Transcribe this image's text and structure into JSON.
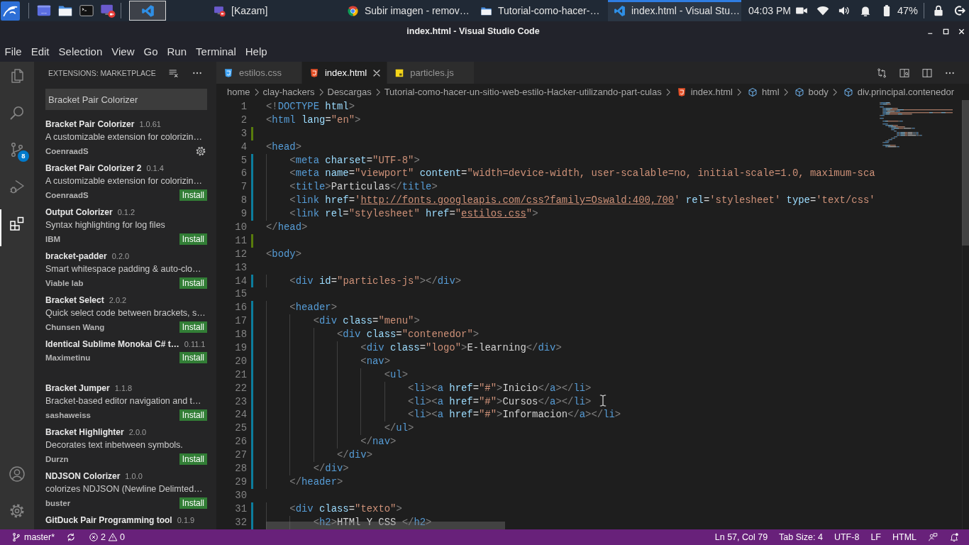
{
  "panel": {
    "launcher_groups": [
      [
        {
          "kind": "menu"
        }
      ],
      [
        {
          "kind": "window"
        },
        {
          "kind": "folder"
        },
        {
          "kind": "terminal"
        },
        {
          "kind": "recorder"
        }
      ]
    ],
    "workspaces": [
      {
        "kind": "editor",
        "selected": true
      }
    ],
    "tasks": [
      {
        "kind": "recorder",
        "label": "[Kazam]",
        "selected": false
      },
      {
        "kind": "browser",
        "label": "Subir imagen - remov…",
        "selected": false
      },
      {
        "kind": "folder",
        "label": "Tutorial-como-hacer-…",
        "selected": false
      },
      {
        "kind": "editor",
        "label": "index.html - Visual Stu…",
        "selected": true
      }
    ],
    "clock": "04:03 PM",
    "tray": [
      {
        "kind": "camera"
      },
      {
        "kind": "wifi"
      },
      {
        "kind": "volume"
      },
      {
        "kind": "bell"
      },
      {
        "kind": "battery"
      }
    ],
    "battery": "47%",
    "session": [
      {
        "kind": "lock"
      },
      {
        "kind": "logout"
      }
    ]
  },
  "window": {
    "title": "index.html - Visual Studio Code"
  },
  "menu": [
    "File",
    "Edit",
    "Selection",
    "View",
    "Go",
    "Run",
    "Terminal",
    "Help"
  ],
  "activity_bar": {
    "items": [
      {
        "kind": "explorer",
        "selected": false
      },
      {
        "kind": "search",
        "selected": false
      },
      {
        "kind": "source-control",
        "selected": false,
        "badge": "8"
      },
      {
        "kind": "run",
        "selected": false
      },
      {
        "kind": "extensions",
        "selected": true
      }
    ],
    "bottom": [
      {
        "kind": "account"
      },
      {
        "kind": "settings"
      }
    ]
  },
  "sidebar": {
    "title": "EXTENSIONS: MARKETPLACE",
    "search": {
      "value": "Bracket Pair Colorizer"
    },
    "extensions": [
      {
        "name": "Bracket Pair Colorizer",
        "version": "1.0.61",
        "description": "A customizable extension for colorizin…",
        "publisher": "CoenraadS",
        "installed": true
      },
      {
        "name": "Bracket Pair Colorizer 2",
        "version": "0.1.4",
        "description": "A customizable extension for colorizin…",
        "publisher": "CoenraadS",
        "installed": false,
        "install_label": "Install"
      },
      {
        "name": "Output Colorizer",
        "version": "0.1.2",
        "description": "Syntax highlighting for log files",
        "publisher": "IBM",
        "installed": false,
        "install_label": "Install"
      },
      {
        "name": "bracket-padder",
        "version": "0.2.0",
        "description": "Smart whitespace padding & auto-clo…",
        "publisher": "Viable lab",
        "installed": false,
        "install_label": "Install"
      },
      {
        "name": "Bracket Select",
        "version": "2.0.2",
        "description": "Quick select code between brackets, s…",
        "publisher": "Chunsen Wang",
        "installed": false,
        "install_label": "Install"
      },
      {
        "name": "Identical Sublime Monokai C# t…",
        "version": "0.11.1",
        "publisher": "Maximetinu",
        "installed": false,
        "install_label": "Install"
      },
      {
        "name": "Bracket Jumper",
        "version": "1.1.8",
        "description": "Bracket-based editor navigation and t…",
        "publisher": "sashaweiss",
        "installed": false,
        "install_label": "Install"
      },
      {
        "name": "Bracket Highlighter",
        "version": "2.0.0",
        "description": "Decorates text inbetween symbols.",
        "publisher": "Durzn",
        "installed": false,
        "install_label": "Install"
      },
      {
        "name": "NDJSON Colorizer",
        "version": "1.0.0",
        "description": "colorizes NDJSON (Newline Delimted…",
        "publisher": "buster",
        "installed": false,
        "install_label": "Install"
      },
      {
        "name": "GitDuck Pair Programming tool",
        "version": "0.1.9"
      }
    ]
  },
  "editor": {
    "tabs": [
      {
        "kind": "css",
        "label": "estilos.css",
        "selected": false
      },
      {
        "kind": "html",
        "label": "index.html",
        "selected": true
      },
      {
        "kind": "js",
        "label": "particles.js",
        "selected": false
      }
    ],
    "breadcrumb": [
      {
        "kind": "folder",
        "label": "home"
      },
      {
        "kind": "folder",
        "label": "clay-hackers"
      },
      {
        "kind": "folder",
        "label": "Descargas"
      },
      {
        "kind": "folder",
        "label": "Tutorial-como-hacer-un-sitio-web-estilo-Hacker-utilizando-part-culas"
      },
      {
        "kind": "html-file",
        "label": "index.html"
      },
      {
        "kind": "element",
        "label": "html"
      },
      {
        "kind": "element",
        "label": "body"
      },
      {
        "kind": "element",
        "label": "div.principal.contenedor"
      }
    ],
    "lines": [
      {
        "number": "1",
        "added": false,
        "modified": false,
        "tokens": [
          {
            "kind": "punct",
            "text": "<!"
          },
          {
            "kind": "tag",
            "text": "DOCTYPE"
          },
          {
            "kind": "attr",
            "text": " html"
          },
          {
            "kind": "punct",
            "text": ">"
          }
        ]
      },
      {
        "number": "2",
        "added": false,
        "modified": false,
        "tokens": [
          {
            "kind": "punct",
            "text": "<"
          },
          {
            "kind": "tag",
            "text": "html"
          },
          {
            "kind": "attr",
            "text": " lang"
          },
          {
            "kind": "text",
            "text": "="
          },
          {
            "kind": "string",
            "text": "\"en\""
          },
          {
            "kind": "punct",
            "text": ">"
          }
        ]
      },
      {
        "number": "3",
        "added": true,
        "modified": false
      },
      {
        "number": "4",
        "added": false,
        "modified": false,
        "tokens": [
          {
            "kind": "punct",
            "text": "<"
          },
          {
            "kind": "tag",
            "text": "head"
          },
          {
            "kind": "punct",
            "text": ">"
          }
        ]
      },
      {
        "number": "5",
        "added": false,
        "modified": true,
        "tokens": [
          {
            "kind": "punct",
            "text": "    <"
          },
          {
            "kind": "tag",
            "text": "meta"
          },
          {
            "kind": "attr",
            "text": " charset"
          },
          {
            "kind": "text",
            "text": "="
          },
          {
            "kind": "string",
            "text": "\"UTF-8\""
          },
          {
            "kind": "punct",
            "text": ">"
          }
        ]
      },
      {
        "number": "6",
        "added": false,
        "modified": true,
        "tokens": [
          {
            "kind": "punct",
            "text": "    <"
          },
          {
            "kind": "tag",
            "text": "meta"
          },
          {
            "kind": "attr",
            "text": " name"
          },
          {
            "kind": "text",
            "text": "="
          },
          {
            "kind": "string",
            "text": "\"viewport\""
          },
          {
            "kind": "attr",
            "text": " content"
          },
          {
            "kind": "text",
            "text": "="
          },
          {
            "kind": "string",
            "text": "\"width=device-width, user-scalable=no, initial-scale=1.0, maximum-sca"
          }
        ]
      },
      {
        "number": "7",
        "added": false,
        "modified": true,
        "tokens": [
          {
            "kind": "punct",
            "text": "    <"
          },
          {
            "kind": "tag",
            "text": "title"
          },
          {
            "kind": "punct",
            "text": ">"
          },
          {
            "kind": "text",
            "text": "Particulas"
          },
          {
            "kind": "punct",
            "text": "</"
          },
          {
            "kind": "tag",
            "text": "title"
          },
          {
            "kind": "punct",
            "text": ">"
          }
        ]
      },
      {
        "number": "8",
        "added": false,
        "modified": true,
        "tokens": [
          {
            "kind": "punct",
            "text": "    <"
          },
          {
            "kind": "tag",
            "text": "link"
          },
          {
            "kind": "attr",
            "text": " href"
          },
          {
            "kind": "text",
            "text": "="
          },
          {
            "kind": "string",
            "text": "'"
          },
          {
            "kind": "link",
            "text": "http://fonts.googleapis.com/css?family=Oswald:400,700"
          },
          {
            "kind": "string",
            "text": "'"
          },
          {
            "kind": "attr",
            "text": " rel"
          },
          {
            "kind": "text",
            "text": "="
          },
          {
            "kind": "string",
            "text": "'stylesheet'"
          },
          {
            "kind": "attr",
            "text": " type"
          },
          {
            "kind": "text",
            "text": "="
          },
          {
            "kind": "string",
            "text": "'text/css'"
          }
        ]
      },
      {
        "number": "9",
        "added": false,
        "modified": true,
        "tokens": [
          {
            "kind": "punct",
            "text": "    <"
          },
          {
            "kind": "tag",
            "text": "link"
          },
          {
            "kind": "attr",
            "text": " rel"
          },
          {
            "kind": "text",
            "text": "="
          },
          {
            "kind": "string",
            "text": "\"stylesheet\""
          },
          {
            "kind": "attr",
            "text": " href"
          },
          {
            "kind": "text",
            "text": "="
          },
          {
            "kind": "string",
            "text": "\""
          },
          {
            "kind": "link",
            "text": "estilos.css"
          },
          {
            "kind": "string",
            "text": "\""
          },
          {
            "kind": "punct",
            "text": ">"
          }
        ]
      },
      {
        "number": "10",
        "added": false,
        "modified": false,
        "tokens": [
          {
            "kind": "punct",
            "text": "</"
          },
          {
            "kind": "tag",
            "text": "head"
          },
          {
            "kind": "punct",
            "text": ">"
          }
        ]
      },
      {
        "number": "11",
        "added": true,
        "modified": false
      },
      {
        "number": "12",
        "added": false,
        "modified": false,
        "tokens": [
          {
            "kind": "punct",
            "text": "<"
          },
          {
            "kind": "tag",
            "text": "body"
          },
          {
            "kind": "punct",
            "text": ">"
          }
        ]
      },
      {
        "number": "13",
        "added": false,
        "modified": false
      },
      {
        "number": "14",
        "added": false,
        "modified": true,
        "tokens": [
          {
            "kind": "punct",
            "text": "    <"
          },
          {
            "kind": "tag",
            "text": "div"
          },
          {
            "kind": "attr",
            "text": " id"
          },
          {
            "kind": "text",
            "text": "="
          },
          {
            "kind": "string",
            "text": "\"particles-js\""
          },
          {
            "kind": "punct",
            "text": "></"
          },
          {
            "kind": "tag",
            "text": "div"
          },
          {
            "kind": "punct",
            "text": ">"
          }
        ]
      },
      {
        "number": "15",
        "added": false,
        "modified": false
      },
      {
        "number": "16",
        "added": false,
        "modified": true,
        "tokens": [
          {
            "kind": "punct",
            "text": "    <"
          },
          {
            "kind": "tag",
            "text": "header"
          },
          {
            "kind": "punct",
            "text": ">"
          }
        ]
      },
      {
        "number": "17",
        "added": false,
        "modified": true,
        "tokens": [
          {
            "kind": "punct",
            "text": "        <"
          },
          {
            "kind": "tag",
            "text": "div"
          },
          {
            "kind": "attr",
            "text": " class"
          },
          {
            "kind": "text",
            "text": "="
          },
          {
            "kind": "string",
            "text": "\"menu\""
          },
          {
            "kind": "punct",
            "text": ">"
          }
        ]
      },
      {
        "number": "18",
        "added": false,
        "modified": true,
        "tokens": [
          {
            "kind": "punct",
            "text": "            <"
          },
          {
            "kind": "tag",
            "text": "div"
          },
          {
            "kind": "attr",
            "text": " class"
          },
          {
            "kind": "text",
            "text": "="
          },
          {
            "kind": "string",
            "text": "\"contenedor\""
          },
          {
            "kind": "punct",
            "text": ">"
          }
        ]
      },
      {
        "number": "19",
        "added": false,
        "modified": true,
        "tokens": [
          {
            "kind": "punct",
            "text": "                <"
          },
          {
            "kind": "tag",
            "text": "div"
          },
          {
            "kind": "attr",
            "text": " class"
          },
          {
            "kind": "text",
            "text": "="
          },
          {
            "kind": "string",
            "text": "\"logo\""
          },
          {
            "kind": "punct",
            "text": ">"
          },
          {
            "kind": "text",
            "text": "E-learning"
          },
          {
            "kind": "punct",
            "text": "</"
          },
          {
            "kind": "tag",
            "text": "div"
          },
          {
            "kind": "punct",
            "text": ">"
          }
        ]
      },
      {
        "number": "20",
        "added": false,
        "modified": true,
        "tokens": [
          {
            "kind": "punct",
            "text": "                <"
          },
          {
            "kind": "tag",
            "text": "nav"
          },
          {
            "kind": "punct",
            "text": ">"
          }
        ]
      },
      {
        "number": "21",
        "added": false,
        "modified": true,
        "tokens": [
          {
            "kind": "punct",
            "text": "                    <"
          },
          {
            "kind": "tag",
            "text": "ul"
          },
          {
            "kind": "punct",
            "text": ">"
          }
        ]
      },
      {
        "number": "22",
        "added": false,
        "modified": true,
        "tokens": [
          {
            "kind": "punct",
            "text": "                        <"
          },
          {
            "kind": "tag",
            "text": "li"
          },
          {
            "kind": "punct",
            "text": "><"
          },
          {
            "kind": "tag",
            "text": "a"
          },
          {
            "kind": "attr",
            "text": " href"
          },
          {
            "kind": "text",
            "text": "="
          },
          {
            "kind": "string",
            "text": "\"#\""
          },
          {
            "kind": "punct",
            "text": ">"
          },
          {
            "kind": "text",
            "text": "Inicio"
          },
          {
            "kind": "punct",
            "text": "</"
          },
          {
            "kind": "tag",
            "text": "a"
          },
          {
            "kind": "punct",
            "text": "></"
          },
          {
            "kind": "tag",
            "text": "li"
          },
          {
            "kind": "punct",
            "text": ">"
          }
        ]
      },
      {
        "number": "23",
        "added": false,
        "modified": true,
        "tokens": [
          {
            "kind": "punct",
            "text": "                        <"
          },
          {
            "kind": "tag",
            "text": "li"
          },
          {
            "kind": "punct",
            "text": "><"
          },
          {
            "kind": "tag",
            "text": "a"
          },
          {
            "kind": "attr",
            "text": " href"
          },
          {
            "kind": "text",
            "text": "="
          },
          {
            "kind": "string",
            "text": "\"#\""
          },
          {
            "kind": "punct",
            "text": ">"
          },
          {
            "kind": "text",
            "text": "Cursos"
          },
          {
            "kind": "punct",
            "text": "</"
          },
          {
            "kind": "tag",
            "text": "a"
          },
          {
            "kind": "punct",
            "text": "></"
          },
          {
            "kind": "tag",
            "text": "li"
          },
          {
            "kind": "punct",
            "text": ">"
          }
        ]
      },
      {
        "number": "24",
        "added": false,
        "modified": true,
        "tokens": [
          {
            "kind": "punct",
            "text": "                        <"
          },
          {
            "kind": "tag",
            "text": "li"
          },
          {
            "kind": "punct",
            "text": "><"
          },
          {
            "kind": "tag",
            "text": "a"
          },
          {
            "kind": "attr",
            "text": " href"
          },
          {
            "kind": "text",
            "text": "="
          },
          {
            "kind": "string",
            "text": "\"#\""
          },
          {
            "kind": "punct",
            "text": ">"
          },
          {
            "kind": "text",
            "text": "Informacion"
          },
          {
            "kind": "punct",
            "text": "</"
          },
          {
            "kind": "tag",
            "text": "a"
          },
          {
            "kind": "punct",
            "text": "></"
          },
          {
            "kind": "tag",
            "text": "li"
          },
          {
            "kind": "punct",
            "text": ">"
          }
        ]
      },
      {
        "number": "25",
        "added": false,
        "modified": true,
        "tokens": [
          {
            "kind": "punct",
            "text": "                    </"
          },
          {
            "kind": "tag",
            "text": "ul"
          },
          {
            "kind": "punct",
            "text": ">"
          }
        ]
      },
      {
        "number": "26",
        "added": false,
        "modified": true,
        "tokens": [
          {
            "kind": "punct",
            "text": "                </"
          },
          {
            "kind": "tag",
            "text": "nav"
          },
          {
            "kind": "punct",
            "text": ">"
          }
        ]
      },
      {
        "number": "27",
        "added": false,
        "modified": true,
        "tokens": [
          {
            "kind": "punct",
            "text": "            </"
          },
          {
            "kind": "tag",
            "text": "div"
          },
          {
            "kind": "punct",
            "text": ">"
          }
        ]
      },
      {
        "number": "28",
        "added": false,
        "modified": true,
        "tokens": [
          {
            "kind": "punct",
            "text": "        </"
          },
          {
            "kind": "tag",
            "text": "div"
          },
          {
            "kind": "punct",
            "text": ">"
          }
        ]
      },
      {
        "number": "29",
        "added": false,
        "modified": true,
        "tokens": [
          {
            "kind": "punct",
            "text": "    </"
          },
          {
            "kind": "tag",
            "text": "header"
          },
          {
            "kind": "punct",
            "text": ">"
          }
        ]
      },
      {
        "number": "30",
        "added": false,
        "modified": false
      },
      {
        "number": "31",
        "added": false,
        "modified": true,
        "tokens": [
          {
            "kind": "punct",
            "text": "    <"
          },
          {
            "kind": "tag",
            "text": "div"
          },
          {
            "kind": "attr",
            "text": " class"
          },
          {
            "kind": "text",
            "text": "="
          },
          {
            "kind": "string",
            "text": "\"texto\""
          },
          {
            "kind": "punct",
            "text": ">"
          }
        ]
      },
      {
        "number": "32",
        "added": false,
        "modified": true,
        "tokens": [
          {
            "kind": "punct",
            "text": "        <"
          },
          {
            "kind": "tag",
            "text": "h2"
          },
          {
            "kind": "punct",
            "text": ">"
          },
          {
            "kind": "text",
            "text": "HTMl Y CSS "
          },
          {
            "kind": "punct",
            "text": "</"
          },
          {
            "kind": "tag",
            "text": "h2"
          },
          {
            "kind": "punct",
            "text": ">"
          }
        ]
      }
    ]
  },
  "status_bar": {
    "branch": "master*",
    "errors": "2",
    "warnings": "0",
    "items": [
      "Ln 57, Col 79",
      "Tab Size: 4",
      "UTF-8",
      "LF",
      "HTML"
    ]
  }
}
